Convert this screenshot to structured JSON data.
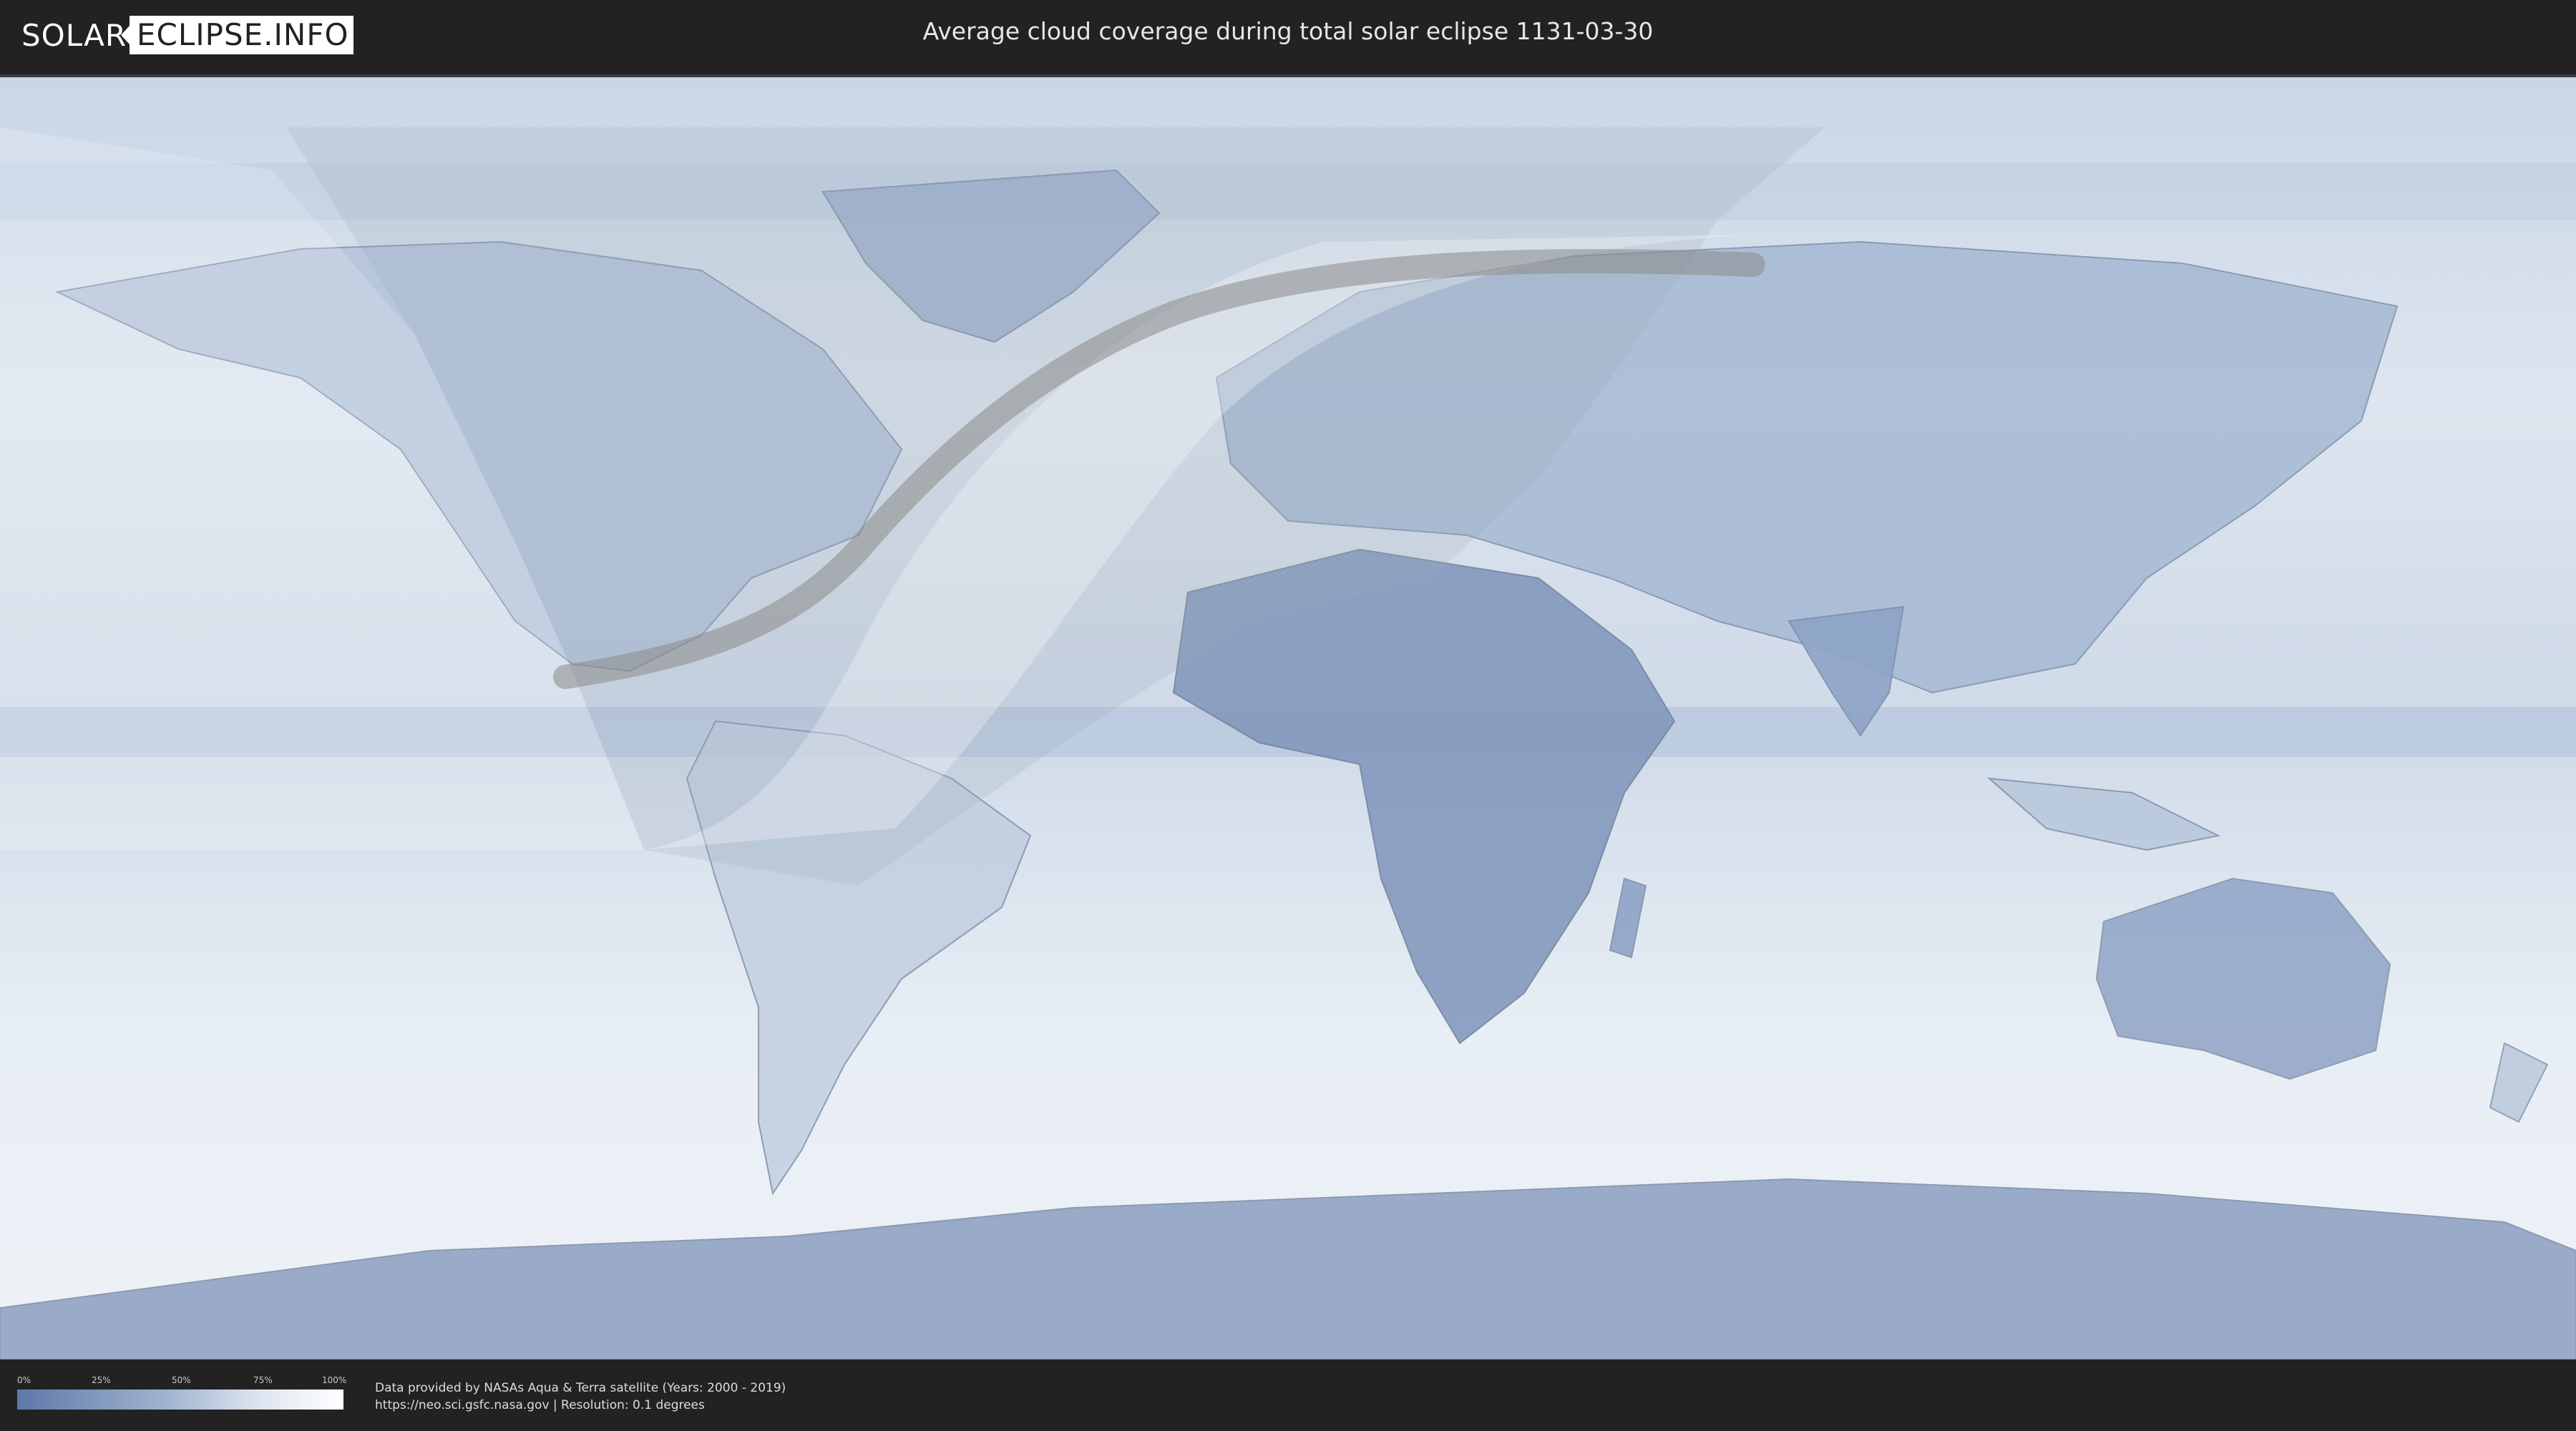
{
  "header": {
    "logo_left": "SOLAR",
    "logo_right": "ECLIPSE.INFO",
    "title": "Average cloud coverage during total solar eclipse 1131-03-30"
  },
  "map": {
    "description_colors": {
      "clear_sky": "#5e78a8",
      "full_cloud": "#ffffff",
      "night_overlay": "#ffffff",
      "eclipse_path": "#8a8a8a"
    }
  },
  "legend": {
    "ticks": [
      "0%",
      "25%",
      "50%",
      "75%",
      "100%"
    ]
  },
  "footer": {
    "credit_line1": "Data provided by NASAs Aqua & Terra satellite (Years: 2000 - 2019)",
    "credit_line2": "https://neo.sci.gsfc.nasa.gov | Resolution: 0.1 degrees"
  }
}
